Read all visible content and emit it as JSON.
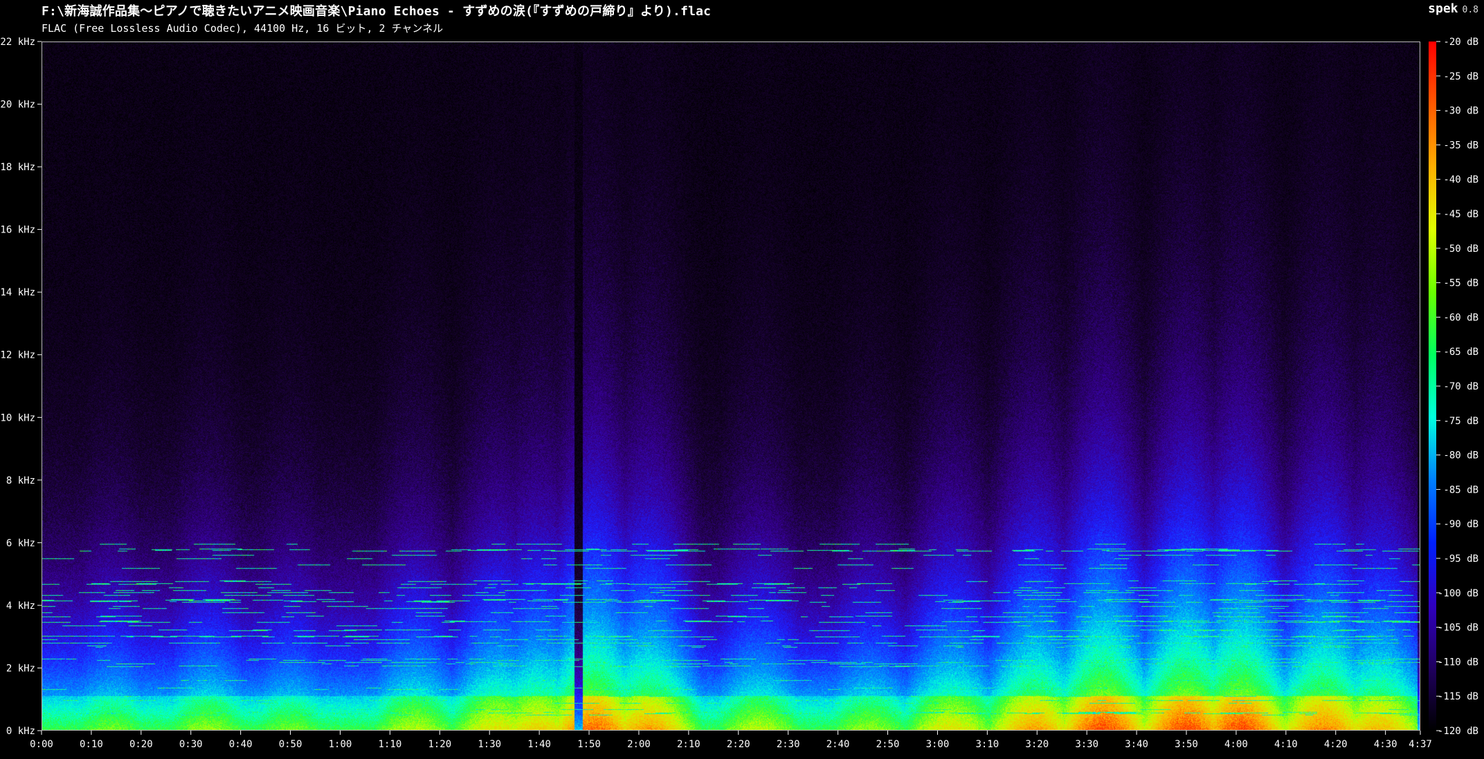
{
  "window": {
    "file_path": "F:\\新海誠作品集〜ピアノで聴きたいアニメ映画音楽\\Piano Echoes - すずめの涙(『すずめの戸締り』より).flac",
    "file_info": "FLAC (Free Lossless Audio Codec), 44100 Hz, 16 ビット, 2 チャンネル",
    "app_name": "spek",
    "app_version": "0.8"
  },
  "spectrogram": {
    "freq_axis": {
      "unit": "kHz",
      "min": 0,
      "max": 22,
      "ticks": [
        0,
        2,
        4,
        6,
        8,
        10,
        12,
        14,
        16,
        18,
        20,
        22
      ],
      "tick_labels": [
        "0 kHz",
        "2 kHz",
        "4 kHz",
        "6 kHz",
        "8 kHz",
        "10 kHz",
        "12 kHz",
        "14 kHz",
        "16 kHz",
        "18 kHz",
        "20 kHz",
        "22 kHz"
      ]
    },
    "time_axis": {
      "duration_seconds": 277,
      "tick_seconds": [
        0,
        10,
        20,
        30,
        40,
        50,
        60,
        70,
        80,
        90,
        100,
        110,
        120,
        130,
        140,
        150,
        160,
        170,
        180,
        190,
        200,
        210,
        220,
        230,
        240,
        250,
        260,
        270,
        277
      ],
      "tick_labels": [
        "0:00",
        "0:10",
        "0:20",
        "0:30",
        "0:40",
        "0:50",
        "1:00",
        "1:10",
        "1:20",
        "1:30",
        "1:40",
        "1:50",
        "2:00",
        "2:10",
        "2:20",
        "2:30",
        "2:40",
        "2:50",
        "3:00",
        "3:10",
        "3:20",
        "3:30",
        "3:40",
        "3:50",
        "4:00",
        "4:10",
        "4:20",
        "4:30",
        "4:37"
      ]
    },
    "db_scale": {
      "min": -120,
      "max": -20,
      "ticks": [
        -20,
        -25,
        -30,
        -35,
        -40,
        -45,
        -50,
        -55,
        -60,
        -65,
        -70,
        -75,
        -80,
        -85,
        -90,
        -95,
        -100,
        -105,
        -110,
        -115,
        -120
      ],
      "tick_labels": [
        "-20 dB",
        "-25 dB",
        "-30 dB",
        "-35 dB",
        "-40 dB",
        "-45 dB",
        "-50 dB",
        "-55 dB",
        "-60 dB",
        "-65 dB",
        "-70 dB",
        "-75 dB",
        "-80 dB",
        "-85 dB",
        "-90 dB",
        "-95 dB",
        "-100 dB",
        "-105 dB",
        "-110 dB",
        "-115 dB",
        "-120 dB"
      ],
      "colors": [
        "#ff0000",
        "#ff5a00",
        "#ffb000",
        "#e0ff00",
        "#6aff00",
        "#00ff60",
        "#00ffe0",
        "#0080ff",
        "#0020ff",
        "#3000c0",
        "#200060",
        "#000000"
      ]
    },
    "colors": {
      "background": "#000000",
      "border": "#bbbbbb",
      "text": "#ffffff"
    }
  }
}
